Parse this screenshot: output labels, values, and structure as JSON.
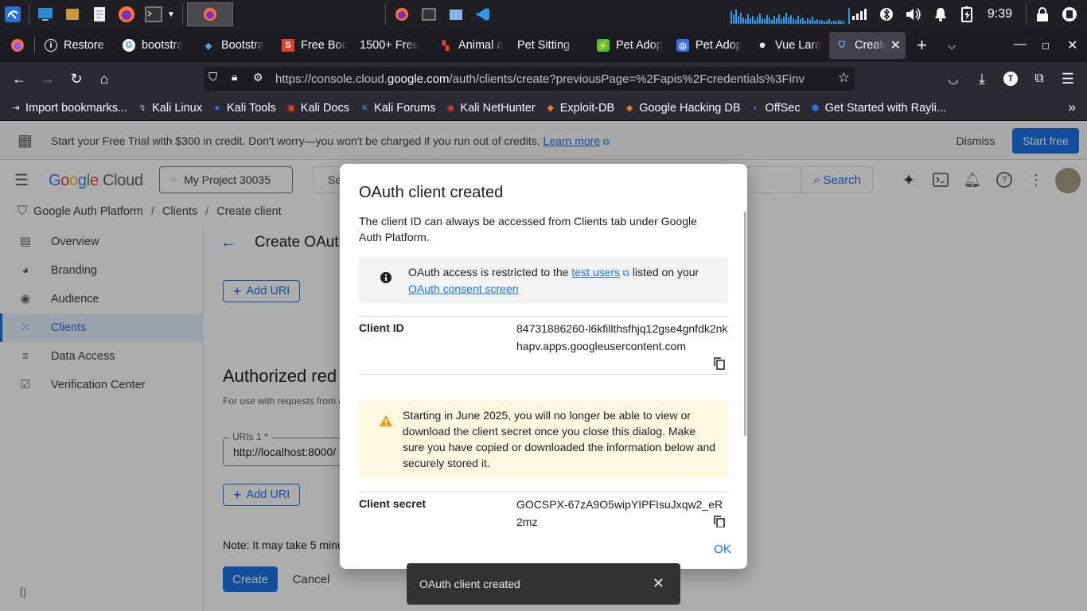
{
  "taskbar": {
    "clock": "9:39"
  },
  "tabs": [
    {
      "title": "Restore S"
    },
    {
      "title": "bootstra"
    },
    {
      "title": "Bootstra"
    },
    {
      "title": "Free Boc"
    },
    {
      "title": "1500+ Free"
    },
    {
      "title": "Animal a"
    },
    {
      "title": "Pet Sitting -"
    },
    {
      "title": "Pet Adop"
    },
    {
      "title": "Pet Adop"
    },
    {
      "title": "Vue Lara"
    },
    {
      "title": "Create"
    }
  ],
  "url": {
    "prefix": "https://console.cloud.",
    "host": "google.com",
    "suffix": "/auth/clients/create?previousPage=%2Fapis%2Fcredentials%3Finv"
  },
  "bookmarks": [
    "Import bookmarks...",
    "Kali Linux",
    "Kali Tools",
    "Kali Docs",
    "Kali Forums",
    "Kali NetHunter",
    "Exploit-DB",
    "Google Hacking DB",
    "OffSec",
    "Get Started with Rayli..."
  ],
  "trial": {
    "text": "Start your Free Trial with $300 in credit. Don't worry—you won't be charged if you run out of credits.",
    "learn_more": "Learn more",
    "dismiss": "Dismiss",
    "start_free": "Start free"
  },
  "header": {
    "logo_google": [
      "G",
      "o",
      "o",
      "g",
      "l",
      "e"
    ],
    "logo_cloud": "Cloud",
    "project": "My Project 30035",
    "search_placeholder": "Se",
    "search_button": "Search"
  },
  "breadcrumb": [
    "Google Auth Platform",
    "Clients",
    "Create client"
  ],
  "sidebar": [
    {
      "label": "Overview",
      "icon": "overview-icon"
    },
    {
      "label": "Branding",
      "icon": "palette-icon"
    },
    {
      "label": "Audience",
      "icon": "person-icon"
    },
    {
      "label": "Clients",
      "icon": "grid-icon"
    },
    {
      "label": "Data Access",
      "icon": "data-access-icon"
    },
    {
      "label": "Verification Center",
      "icon": "verification-icon"
    }
  ],
  "main": {
    "title": "Create OAuth",
    "add_uri": "Add URI",
    "section_heading": "Authorized red",
    "section_desc": "For use with requests from a",
    "uri_label": "URIs 1 *",
    "uri_value": "http://localhost:8000/",
    "note": "Note: It may take 5 minu",
    "create": "Create",
    "cancel": "Cancel"
  },
  "dialog": {
    "title": "OAuth client created",
    "intro": "The client ID can always be accessed from Clients tab under Google Auth Platform.",
    "info_prefix": "OAuth access is restricted to the ",
    "info_link1": "test users",
    "info_middle": " listed on your ",
    "info_link2": "OAuth consent screen",
    "client_id_label": "Client ID",
    "client_id_value": "84731886260-l6kfillthsfhjq12gse4gnfdk2nkhapv.apps.googleusercontent.com",
    "warning": "Starting in June 2025, you will no longer be able to view or download the client secret once you close this dialog. Make sure you have copied or downloaded the information below and securely stored it.",
    "client_secret_label": "Client secret",
    "client_secret_value": "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",
    "ok": "OK"
  },
  "snackbar": {
    "text": "OAuth client created"
  },
  "colors": {
    "accent": "#1a73e8",
    "warning_bg": "#fef7e0",
    "warning_icon": "#f29900"
  }
}
